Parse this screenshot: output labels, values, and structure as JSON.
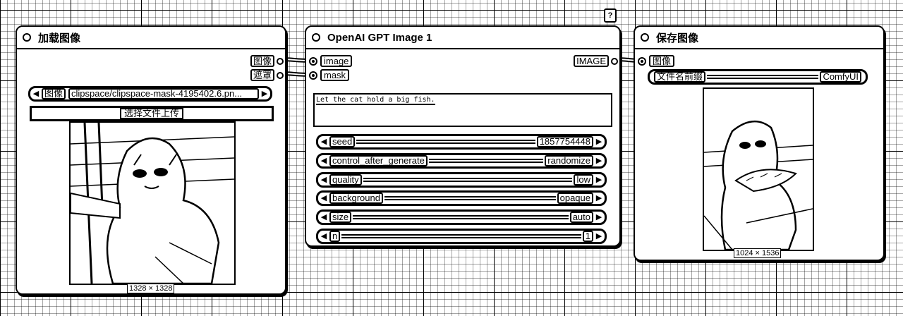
{
  "load_node": {
    "title": "加载图像",
    "outputs": [
      "图像",
      "遮罩"
    ],
    "image_widget": {
      "name": "图像",
      "value": "clipspace/clipspace-mask-4195402.6.pn..."
    },
    "upload_label": "选择文件上传",
    "image_size": "1328 × 1328"
  },
  "gpt_node": {
    "title": "OpenAI GPT Image 1",
    "inputs": [
      "image",
      "mask"
    ],
    "output": "IMAGE",
    "prompt": "Let the cat hold a big fish.",
    "widgets": [
      {
        "name": "seed",
        "value": "1857754448"
      },
      {
        "name": "control_after_generate",
        "value": "randomize"
      },
      {
        "name": "quality",
        "value": "low"
      },
      {
        "name": "background",
        "value": "opaque"
      },
      {
        "name": "size",
        "value": "auto"
      },
      {
        "name": "n",
        "value": "1"
      }
    ],
    "help_badge": "?"
  },
  "save_node": {
    "title": "保存图像",
    "input": "图像",
    "prefix_widget": {
      "name": "文件名前缀",
      "value": "ComfyUI"
    },
    "image_size": "1024 × 1536"
  }
}
